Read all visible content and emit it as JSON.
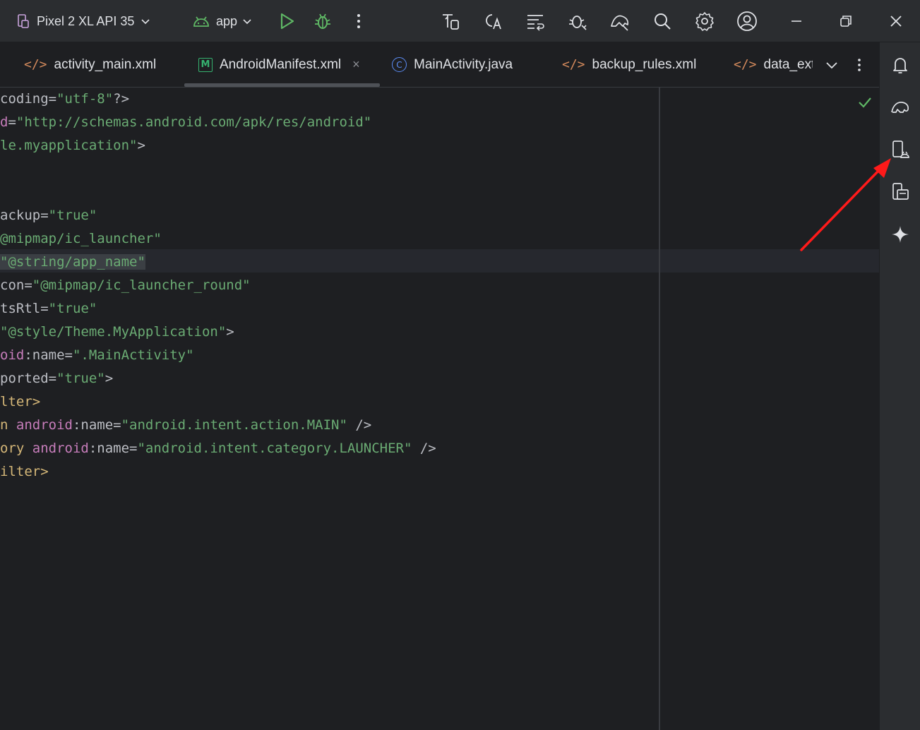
{
  "toolbar": {
    "device": "Pixel 2 XL API 35",
    "config": "app",
    "icons": [
      "device-icon",
      "android-icon",
      "chevron-down-icon",
      "run-icon",
      "debug-icon",
      "more-icon",
      "sync-icon",
      "translate-icon",
      "format-icon",
      "bug-scan-icon",
      "profiler-icon",
      "search-icon",
      "settings-icon",
      "account-icon",
      "minimize-icon",
      "restore-icon",
      "close-icon"
    ]
  },
  "tabs": [
    {
      "label": "activity_main.xml",
      "icon": "xml-icon"
    },
    {
      "label": "AndroidManifest.xml",
      "icon": "manifest-icon",
      "icon_text": "M",
      "active": true,
      "close": "×"
    },
    {
      "label": "MainActivity.java",
      "icon": "class-icon",
      "icon_text": "C"
    },
    {
      "label": "backup_rules.xml",
      "icon": "xml-icon"
    },
    {
      "label": "data_ext",
      "icon": "xml-icon"
    }
  ],
  "code": {
    "line1": {
      "a": "coding=",
      "b": "\"utf-8\"",
      "c": "?>"
    },
    "line2": {
      "a": "d",
      "b": "=",
      "c": "\"http://schemas.android.com/apk/res/android\""
    },
    "line3": {
      "a": "le.myapplication\"",
      "b": ">"
    },
    "line4": {
      "a": "ackup=",
      "b": "\"true\""
    },
    "line5": {
      "a": "@mipmap/ic_launcher\""
    },
    "line6": {
      "a": "\"@string/app_name\""
    },
    "line7": {
      "a": "con=",
      "b": "\"@mipmap/ic_launcher_round\""
    },
    "line8": {
      "a": "tsRtl=",
      "b": "\"true\""
    },
    "line9": {
      "a": "\"@style/Theme.MyApplication\"",
      "b": ">"
    },
    "line10": {
      "a": "oid",
      "b": ":name=",
      "c": "\".MainActivity\""
    },
    "line11": {
      "a": "ported=",
      "b": "\"true\"",
      "c": ">"
    },
    "line12": {
      "a": "lter>"
    },
    "line13": {
      "a": "n ",
      "b": "android",
      "c": ":name=",
      "d": "\"android.intent.action.MAIN\"",
      "e": " />"
    },
    "line14": {
      "a": "ory ",
      "b": "android",
      "c": ":name=",
      "d": "\"android.intent.category.LAUNCHER\"",
      "e": " />"
    },
    "line15": {
      "a": "ilter>"
    }
  },
  "right_strip": {
    "icons": [
      "notifications-icon",
      "gradle-icon",
      "device-manager-icon",
      "running-devices-icon",
      "gemini-icon"
    ]
  },
  "colors": {
    "string": "#6aab73",
    "attribute": "#c77dbb",
    "tag": "#d5b778",
    "annotation_arrow": "#ff1a1a"
  }
}
